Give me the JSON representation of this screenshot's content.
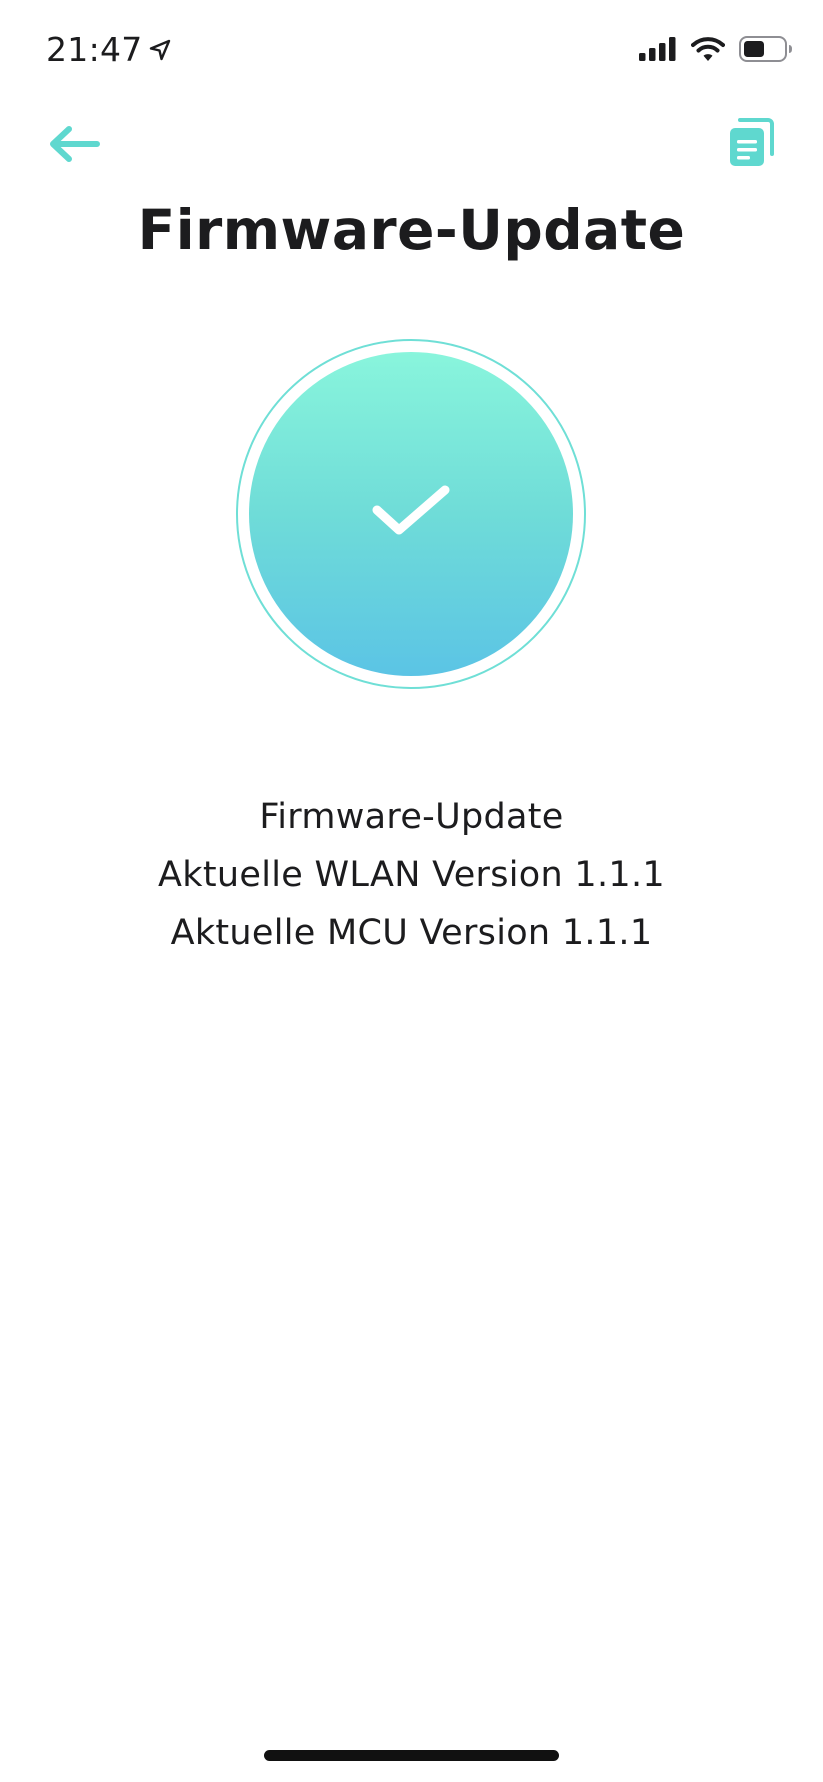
{
  "status_bar": {
    "time": "21:47",
    "icons": [
      "location-arrow-icon",
      "signal-icon",
      "wifi-icon",
      "battery-icon"
    ]
  },
  "nav": {
    "back_icon": "arrow-left-icon",
    "doc_icon": "documents-icon",
    "accent_color": "#5fd8cf"
  },
  "page": {
    "title": "Firmware-Update"
  },
  "status": {
    "icon": "checkmark-icon",
    "gradient_top": "#89f5dc",
    "gradient_bottom": "#5bc4e5"
  },
  "info": {
    "line1": "Firmware-Update",
    "line2": "Aktuelle WLAN Version 1.1.1",
    "line3": "Aktuelle MCU Version 1.1.1"
  }
}
